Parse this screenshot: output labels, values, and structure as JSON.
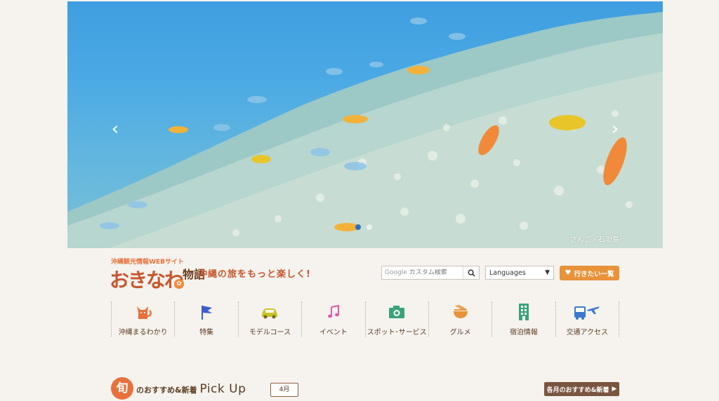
{
  "hero": {
    "prev_arrow": "‹",
    "next_arrow": "›",
    "caption": "さんご／石垣島",
    "slide_count": 2,
    "active_slide": 1
  },
  "logo": {
    "subtitle": "沖縄観光情報WEBサイト",
    "main": "おきなわ",
    "small": "物語"
  },
  "tagline": "沖縄の旅をもっと楽しく!",
  "search": {
    "brand": "Google",
    "placeholder": "カスタム検索"
  },
  "languages": {
    "selected": "Languages"
  },
  "wishlist": {
    "label": "行きたい一覧"
  },
  "nav": {
    "items": [
      {
        "label": "沖縄まるわかり",
        "icon": "cat-icon"
      },
      {
        "label": "特集",
        "icon": "flag-icon"
      },
      {
        "label": "モデルコース",
        "icon": "car-icon"
      },
      {
        "label": "イベント",
        "icon": "music-note-icon"
      },
      {
        "label": "スポット･サービス",
        "icon": "camera-icon"
      },
      {
        "label": "グルメ",
        "icon": "noodle-bowl-icon"
      },
      {
        "label": "宿泊情報",
        "icon": "building-icon"
      },
      {
        "label": "交通アクセス",
        "icon": "bus-plane-icon"
      }
    ]
  },
  "pickup": {
    "badge": "旬",
    "title_ja": "のおすすめ&新着",
    "title_en": "Pick Up",
    "month": "4月",
    "monthly_button": "各月のおすすめ&新着"
  },
  "colors": {
    "accent_orange": "#e8703a",
    "button_orange": "#e8923a",
    "brown": "#7a5540",
    "background": "#f6f3ee"
  }
}
